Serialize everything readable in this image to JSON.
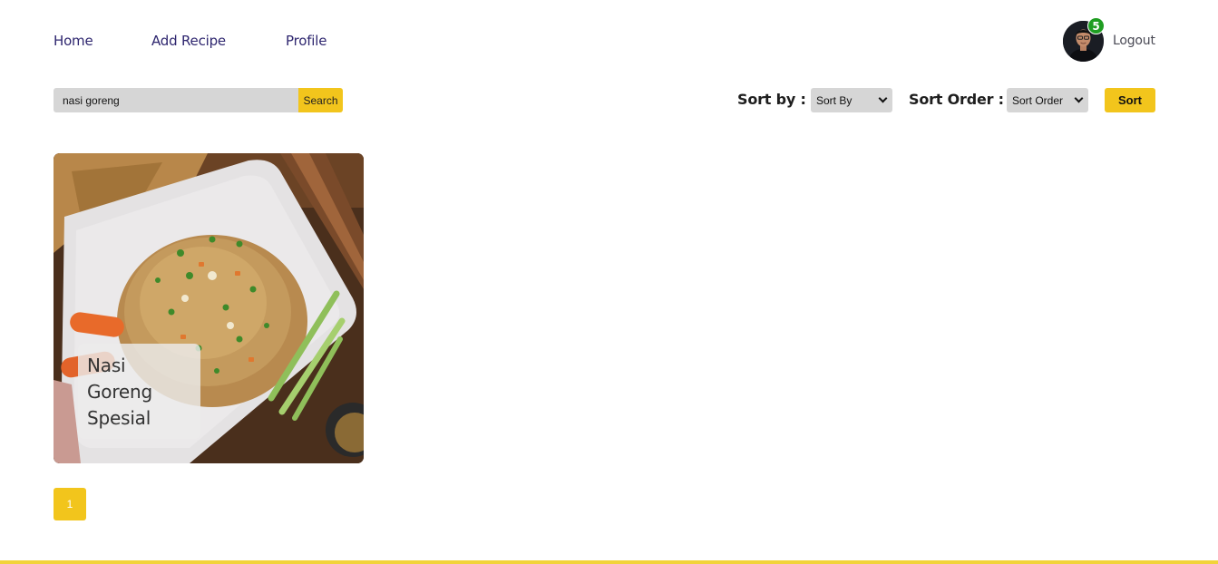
{
  "nav": {
    "home": "Home",
    "add_recipe": "Add Recipe",
    "profile": "Profile",
    "notification_count": "5",
    "logout": "Logout"
  },
  "search": {
    "value": "nasi goreng",
    "button": "Search"
  },
  "sort": {
    "sort_by_label": "Sort by :",
    "sort_by_value": "Sort By",
    "sort_order_label": "Sort Order :",
    "sort_order_value": "Sort Order",
    "button": "Sort"
  },
  "recipes": [
    {
      "title": "Nasi\nGoreng\nSpesial"
    }
  ],
  "pagination": {
    "current_page": "1"
  },
  "colors": {
    "accent": "#f2c51c",
    "nav_text": "#2e266f",
    "badge": "#1f9d22",
    "input_bg": "#d6d6d6"
  }
}
